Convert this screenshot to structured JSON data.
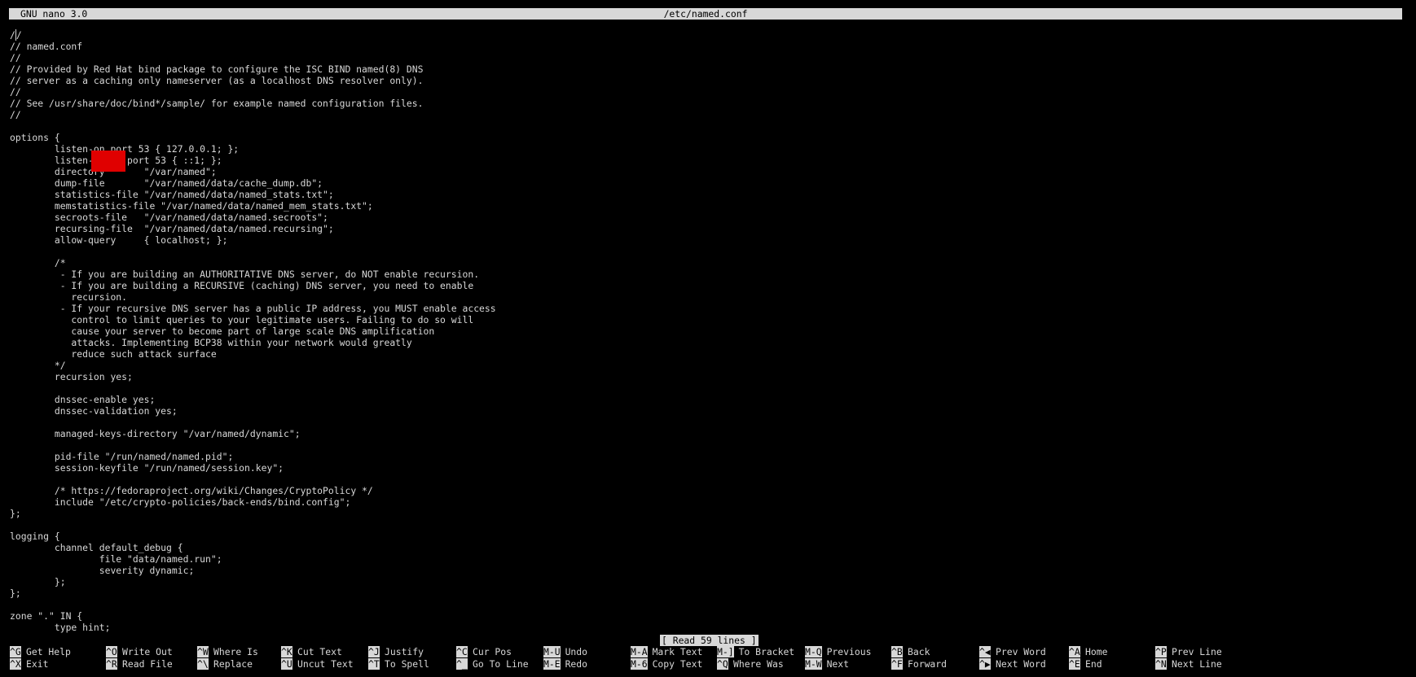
{
  "app": {
    "version_label": "GNU nano 3.0",
    "file_path": "/etc/named.conf"
  },
  "buffer": {
    "lines": [
      "//",
      "// named.conf",
      "//",
      "// Provided by Red Hat bind package to configure the ISC BIND named(8) DNS",
      "// server as a caching only nameserver (as a localhost DNS resolver only).",
      "//",
      "// See /usr/share/doc/bind*/sample/ for example named configuration files.",
      "//",
      "",
      "options {",
      "        listen-on port 53 { 127.0.0.1; };",
      "        listen-on-v6 port 53 { ::1; };",
      "        directory       \"/var/named\";",
      "        dump-file       \"/var/named/data/cache_dump.db\";",
      "        statistics-file \"/var/named/data/named_stats.txt\";",
      "        memstatistics-file \"/var/named/data/named_mem_stats.txt\";",
      "        secroots-file   \"/var/named/data/named.secroots\";",
      "        recursing-file  \"/var/named/data/named.recursing\";",
      "        allow-query     { localhost; };",
      "",
      "        /*",
      "         - If you are building an AUTHORITATIVE DNS server, do NOT enable recursion.",
      "         - If you are building a RECURSIVE (caching) DNS server, you need to enable",
      "           recursion.",
      "         - If your recursive DNS server has a public IP address, you MUST enable access",
      "           control to limit queries to your legitimate users. Failing to do so will",
      "           cause your server to become part of large scale DNS amplification",
      "           attacks. Implementing BCP38 within your network would greatly",
      "           reduce such attack surface",
      "        */",
      "        recursion yes;",
      "",
      "        dnssec-enable yes;",
      "        dnssec-validation yes;",
      "",
      "        managed-keys-directory \"/var/named/dynamic\";",
      "",
      "        pid-file \"/run/named/named.pid\";",
      "        session-keyfile \"/run/named/session.key\";",
      "",
      "        /* https://fedoraproject.org/wiki/Changes/CryptoPolicy */",
      "        include \"/etc/crypto-policies/back-ends/bind.config\";",
      "};",
      "",
      "logging {",
      "        channel default_debug {",
      "                file \"data/named.run\";",
      "                severity dynamic;",
      "        };",
      "};",
      "",
      "zone \".\" IN {",
      "        type hint;"
    ]
  },
  "status_message": "[ Read 59 lines ]",
  "shortcuts": {
    "top": [
      {
        "key": "^G",
        "label": "Get Help"
      },
      {
        "key": "^O",
        "label": "Write Out"
      },
      {
        "key": "^W",
        "label": "Where Is"
      },
      {
        "key": "^K",
        "label": "Cut Text"
      },
      {
        "key": "^J",
        "label": "Justify"
      },
      {
        "key": "^C",
        "label": "Cur Pos"
      },
      {
        "key": "M-U",
        "label": "Undo"
      },
      {
        "key": "M-A",
        "label": "Mark Text"
      },
      {
        "key": "M-]",
        "label": "To Bracket"
      },
      {
        "key": "M-Q",
        "label": "Previous"
      },
      {
        "key": "^B",
        "label": "Back"
      },
      {
        "key": "^◀",
        "label": "Prev Word"
      },
      {
        "key": "^A",
        "label": "Home"
      },
      {
        "key": "^P",
        "label": "Prev Line"
      }
    ],
    "bottom": [
      {
        "key": "^X",
        "label": "Exit"
      },
      {
        "key": "^R",
        "label": "Read File"
      },
      {
        "key": "^\\",
        "label": "Replace"
      },
      {
        "key": "^U",
        "label": "Uncut Text"
      },
      {
        "key": "^T",
        "label": "To Spell"
      },
      {
        "key": "^_",
        "label": "Go To Line"
      },
      {
        "key": "M-E",
        "label": "Redo"
      },
      {
        "key": "M-6",
        "label": "Copy Text"
      },
      {
        "key": "^Q",
        "label": "Where Was"
      },
      {
        "key": "M-W",
        "label": "Next"
      },
      {
        "key": "^F",
        "label": "Forward"
      },
      {
        "key": "^▶",
        "label": "Next Word"
      },
      {
        "key": "^E",
        "label": "End"
      },
      {
        "key": "^N",
        "label": "Next Line"
      }
    ]
  }
}
